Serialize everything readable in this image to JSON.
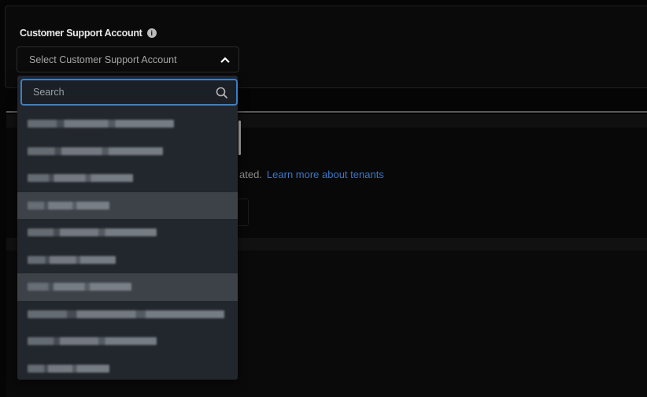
{
  "form": {
    "label": "Customer Support Account",
    "info_icon": "i",
    "select_placeholder": "Select Customer Support Account"
  },
  "dropdown": {
    "search_placeholder": "Search",
    "items": [
      {
        "redacted": true,
        "highlighted": false
      },
      {
        "redacted": true,
        "highlighted": false
      },
      {
        "redacted": true,
        "highlighted": false
      },
      {
        "redacted": true,
        "highlighted": true
      },
      {
        "redacted": true,
        "highlighted": false
      },
      {
        "redacted": true,
        "highlighted": false
      },
      {
        "redacted": true,
        "highlighted": true
      },
      {
        "redacted": true,
        "highlighted": false
      },
      {
        "redacted": true,
        "highlighted": false
      },
      {
        "redacted": true,
        "highlighted": false
      }
    ]
  },
  "background": {
    "description_fragment": "ated.",
    "learn_more_link": "Learn more about tenants"
  },
  "colors": {
    "accent": "#3c7fc4",
    "link": "#3d77c2"
  }
}
